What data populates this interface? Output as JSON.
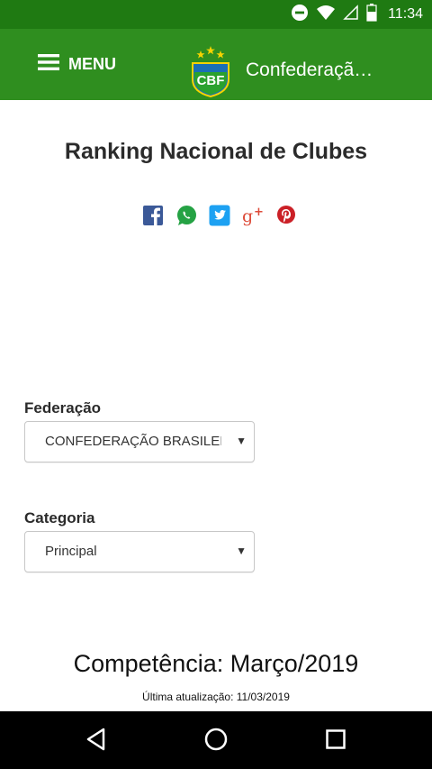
{
  "status_bar": {
    "time": "11:34",
    "icons": [
      "do-not-disturb-icon",
      "wifi-icon",
      "signal-icon",
      "battery-icon"
    ]
  },
  "header": {
    "menu_label": "MENU",
    "title": "Confederaçã…",
    "logo_text": "CBF",
    "colors": {
      "status_bar": "#1f7a12",
      "header": "#2f8e1f"
    }
  },
  "page": {
    "title": "Ranking Nacional de Clubes",
    "share_icons": [
      "facebook-icon",
      "whatsapp-icon",
      "twitter-icon",
      "google-plus-icon",
      "pinterest-icon"
    ]
  },
  "filters": {
    "federacao": {
      "label": "Federação",
      "value": "CONFEDERAÇÃO BRASILEIRA"
    },
    "categoria": {
      "label": "Categoria",
      "value": "Principal"
    }
  },
  "competencia": {
    "text": "Competência: Março/2019",
    "updated": "Última atualização: 11/03/2019"
  },
  "nav": {
    "buttons": [
      "back-icon",
      "home-icon",
      "recents-icon"
    ]
  }
}
